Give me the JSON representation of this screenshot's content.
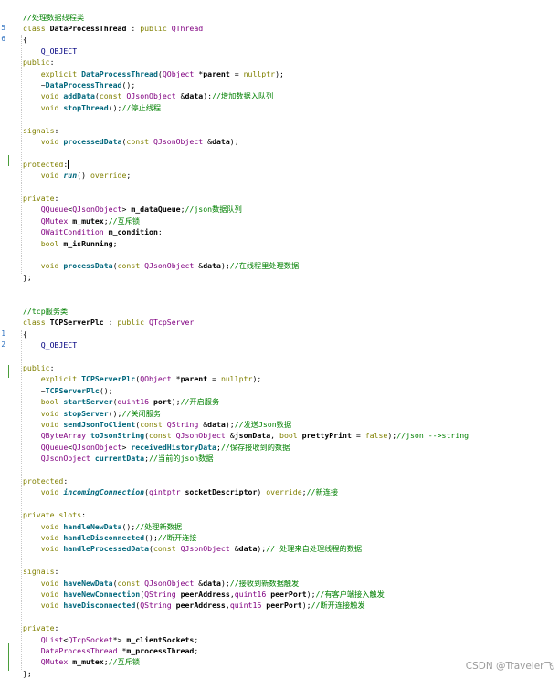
{
  "watermark": "CSDN @Traveler飞",
  "gutter_numbers": {
    "l1": "5",
    "l2": "6",
    "l28": "1",
    "l29": "2"
  },
  "lines": [
    [
      [
        "cm",
        "//处理数据线程类"
      ]
    ],
    [
      [
        "kw",
        "class "
      ],
      [
        "id",
        "DataProcessThread"
      ],
      [
        "pl",
        " : "
      ],
      [
        "kw",
        "public "
      ],
      [
        "ty",
        "QThread"
      ]
    ],
    [
      [
        "pl",
        "{"
      ]
    ],
    [
      [
        "pl",
        "    "
      ],
      [
        "mac",
        "Q_OBJECT"
      ]
    ],
    [
      [
        "kw",
        "public"
      ],
      [
        "pl",
        ":"
      ]
    ],
    [
      [
        "pl",
        "    "
      ],
      [
        "kw",
        "explicit "
      ],
      [
        "fn",
        "DataProcessThread"
      ],
      [
        "pl",
        "("
      ],
      [
        "ty",
        "QObject"
      ],
      [
        "pl",
        " *"
      ],
      [
        "id",
        "parent"
      ],
      [
        "pl",
        " = "
      ],
      [
        "kw",
        "nullptr"
      ],
      [
        "pl",
        ");"
      ]
    ],
    [
      [
        "pl",
        "    ~"
      ],
      [
        "fn",
        "DataProcessThread"
      ],
      [
        "pl",
        "();"
      ]
    ],
    [
      [
        "pl",
        "    "
      ],
      [
        "kw",
        "void "
      ],
      [
        "fn",
        "addData"
      ],
      [
        "pl",
        "("
      ],
      [
        "kw",
        "const "
      ],
      [
        "ty",
        "QJsonObject"
      ],
      [
        "pl",
        " &"
      ],
      [
        "id",
        "data"
      ],
      [
        "pl",
        ");"
      ],
      [
        "cm",
        "//增加数据入队列"
      ]
    ],
    [
      [
        "pl",
        "    "
      ],
      [
        "kw",
        "void "
      ],
      [
        "fn",
        "stopThread"
      ],
      [
        "pl",
        "();"
      ],
      [
        "cm",
        "//停止线程"
      ]
    ],
    [],
    [
      [
        "kw",
        "signals"
      ],
      [
        "pl",
        ":"
      ]
    ],
    [
      [
        "pl",
        "    "
      ],
      [
        "kw",
        "void "
      ],
      [
        "fn",
        "processedData"
      ],
      [
        "pl",
        "("
      ],
      [
        "kw",
        "const "
      ],
      [
        "ty",
        "QJsonObject"
      ],
      [
        "pl",
        " &"
      ],
      [
        "id",
        "data"
      ],
      [
        "pl",
        ");"
      ]
    ],
    [],
    [
      [
        "kw",
        "protected"
      ],
      [
        "pl",
        ":"
      ],
      [
        "cursor",
        ""
      ]
    ],
    [
      [
        "pl",
        "    "
      ],
      [
        "kw",
        "void "
      ],
      [
        "it",
        "run"
      ],
      [
        "pl",
        "() "
      ],
      [
        "kw",
        "override"
      ],
      [
        "pl",
        ";"
      ]
    ],
    [],
    [
      [
        "kw",
        "private"
      ],
      [
        "pl",
        ":"
      ]
    ],
    [
      [
        "pl",
        "    "
      ],
      [
        "ty",
        "QQueue"
      ],
      [
        "pl",
        "<"
      ],
      [
        "ty",
        "QJsonObject"
      ],
      [
        "pl",
        "> "
      ],
      [
        "id",
        "m_dataQueue"
      ],
      [
        "pl",
        ";"
      ],
      [
        "cm",
        "//json数据队列"
      ]
    ],
    [
      [
        "pl",
        "    "
      ],
      [
        "ty",
        "QMutex"
      ],
      [
        "pl",
        " "
      ],
      [
        "id",
        "m_mutex"
      ],
      [
        "pl",
        ";"
      ],
      [
        "cm",
        "//互斥锁"
      ]
    ],
    [
      [
        "pl",
        "    "
      ],
      [
        "ty",
        "QWaitCondition"
      ],
      [
        "pl",
        " "
      ],
      [
        "id",
        "m_condition"
      ],
      [
        "pl",
        ";"
      ]
    ],
    [
      [
        "pl",
        "    "
      ],
      [
        "kw",
        "bool "
      ],
      [
        "id",
        "m_isRunning"
      ],
      [
        "pl",
        ";"
      ]
    ],
    [],
    [
      [
        "pl",
        "    "
      ],
      [
        "kw",
        "void "
      ],
      [
        "fn",
        "processData"
      ],
      [
        "pl",
        "("
      ],
      [
        "kw",
        "const "
      ],
      [
        "ty",
        "QJsonObject"
      ],
      [
        "pl",
        " &"
      ],
      [
        "id",
        "data"
      ],
      [
        "pl",
        ");"
      ],
      [
        "cm",
        "//在线程里处理数据"
      ]
    ],
    [
      [
        "pl",
        "};"
      ]
    ],
    [],
    [],
    [
      [
        "cm",
        "//tcp服务类"
      ]
    ],
    [
      [
        "kw",
        "class "
      ],
      [
        "id",
        "TCPServerPlc"
      ],
      [
        "pl",
        " : "
      ],
      [
        "kw",
        "public "
      ],
      [
        "ty",
        "QTcpServer"
      ]
    ],
    [
      [
        "pl",
        "{"
      ]
    ],
    [
      [
        "pl",
        "    "
      ],
      [
        "mac",
        "Q_OBJECT"
      ]
    ],
    [],
    [
      [
        "kw",
        "public"
      ],
      [
        "pl",
        ":"
      ]
    ],
    [
      [
        "pl",
        "    "
      ],
      [
        "kw",
        "explicit "
      ],
      [
        "fn",
        "TCPServerPlc"
      ],
      [
        "pl",
        "("
      ],
      [
        "ty",
        "QObject"
      ],
      [
        "pl",
        " *"
      ],
      [
        "id",
        "parent"
      ],
      [
        "pl",
        " = "
      ],
      [
        "kw",
        "nullptr"
      ],
      [
        "pl",
        ");"
      ]
    ],
    [
      [
        "pl",
        "    ~"
      ],
      [
        "fn",
        "TCPServerPlc"
      ],
      [
        "pl",
        "();"
      ]
    ],
    [
      [
        "pl",
        "    "
      ],
      [
        "kw",
        "bool "
      ],
      [
        "fn",
        "startServer"
      ],
      [
        "pl",
        "("
      ],
      [
        "ty",
        "quint16"
      ],
      [
        "pl",
        " "
      ],
      [
        "id",
        "port"
      ],
      [
        "pl",
        ");"
      ],
      [
        "cm",
        "//开启服务"
      ]
    ],
    [
      [
        "pl",
        "    "
      ],
      [
        "kw",
        "void "
      ],
      [
        "fn",
        "stopServer"
      ],
      [
        "pl",
        "();"
      ],
      [
        "cm",
        "//关闭服务"
      ]
    ],
    [
      [
        "pl",
        "    "
      ],
      [
        "kw",
        "void "
      ],
      [
        "fn",
        "sendJsonToClient"
      ],
      [
        "pl",
        "("
      ],
      [
        "kw",
        "const "
      ],
      [
        "ty",
        "QString"
      ],
      [
        "pl",
        " &"
      ],
      [
        "id",
        "data"
      ],
      [
        "pl",
        ");"
      ],
      [
        "cm",
        "//发送Json数据"
      ]
    ],
    [
      [
        "pl",
        "    "
      ],
      [
        "ty",
        "QByteArray"
      ],
      [
        "pl",
        " "
      ],
      [
        "fn",
        "toJsonString"
      ],
      [
        "pl",
        "("
      ],
      [
        "kw",
        "const "
      ],
      [
        "ty",
        "QJsonObject"
      ],
      [
        "pl",
        " &"
      ],
      [
        "id",
        "jsonData"
      ],
      [
        "pl",
        ", "
      ],
      [
        "kw",
        "bool "
      ],
      [
        "id",
        "prettyPrint"
      ],
      [
        "pl",
        " = "
      ],
      [
        "kw",
        "false"
      ],
      [
        "pl",
        ");"
      ],
      [
        "cm",
        "//json -->string"
      ]
    ],
    [
      [
        "pl",
        "    "
      ],
      [
        "ty",
        "QQueue"
      ],
      [
        "pl",
        "<"
      ],
      [
        "ty",
        "QJsonObject"
      ],
      [
        "pl",
        "> "
      ],
      [
        "fn",
        "receivedHistoryData"
      ],
      [
        "pl",
        ";"
      ],
      [
        "cm",
        "//保存接收到的数据"
      ]
    ],
    [
      [
        "pl",
        "    "
      ],
      [
        "ty",
        "QJsonObject"
      ],
      [
        "pl",
        " "
      ],
      [
        "fn",
        "currentData"
      ],
      [
        "pl",
        ";"
      ],
      [
        "cm",
        "//当前的json数据"
      ]
    ],
    [],
    [
      [
        "kw",
        "protected"
      ],
      [
        "pl",
        ":"
      ]
    ],
    [
      [
        "pl",
        "    "
      ],
      [
        "kw",
        "void "
      ],
      [
        "it",
        "incomingConnection"
      ],
      [
        "pl",
        "("
      ],
      [
        "ty",
        "qintptr"
      ],
      [
        "pl",
        " "
      ],
      [
        "id",
        "socketDescriptor"
      ],
      [
        "pl",
        ") "
      ],
      [
        "kw",
        "override"
      ],
      [
        "pl",
        ";"
      ],
      [
        "cm",
        "//新连接"
      ]
    ],
    [],
    [
      [
        "kw",
        "private slots"
      ],
      [
        "pl",
        ":"
      ]
    ],
    [
      [
        "pl",
        "    "
      ],
      [
        "kw",
        "void "
      ],
      [
        "fn",
        "handleNewData"
      ],
      [
        "pl",
        "();"
      ],
      [
        "cm",
        "//处理新数据"
      ]
    ],
    [
      [
        "pl",
        "    "
      ],
      [
        "kw",
        "void "
      ],
      [
        "fn",
        "handleDisconnected"
      ],
      [
        "pl",
        "();"
      ],
      [
        "cm",
        "//断开连接"
      ]
    ],
    [
      [
        "pl",
        "    "
      ],
      [
        "kw",
        "void "
      ],
      [
        "fn",
        "handleProcessedData"
      ],
      [
        "pl",
        "("
      ],
      [
        "kw",
        "const "
      ],
      [
        "ty",
        "QJsonObject"
      ],
      [
        "pl",
        " &"
      ],
      [
        "id",
        "data"
      ],
      [
        "pl",
        ");"
      ],
      [
        "cm",
        "// 处理来自处理线程的数据"
      ]
    ],
    [],
    [
      [
        "kw",
        "signals"
      ],
      [
        "pl",
        ":"
      ]
    ],
    [
      [
        "pl",
        "    "
      ],
      [
        "kw",
        "void "
      ],
      [
        "fn",
        "haveNewData"
      ],
      [
        "pl",
        "("
      ],
      [
        "kw",
        "const "
      ],
      [
        "ty",
        "QJsonObject"
      ],
      [
        "pl",
        " &"
      ],
      [
        "id",
        "data"
      ],
      [
        "pl",
        ");"
      ],
      [
        "cm",
        "//接收到新数据触发"
      ]
    ],
    [
      [
        "pl",
        "    "
      ],
      [
        "kw",
        "void "
      ],
      [
        "fn",
        "haveNewConnection"
      ],
      [
        "pl",
        "("
      ],
      [
        "ty",
        "QString"
      ],
      [
        "pl",
        " "
      ],
      [
        "id",
        "peerAddress"
      ],
      [
        "pl",
        ","
      ],
      [
        "ty",
        "quint16"
      ],
      [
        "pl",
        " "
      ],
      [
        "id",
        "peerPort"
      ],
      [
        "pl",
        ");"
      ],
      [
        "cm",
        "//有客户端接入触发"
      ]
    ],
    [
      [
        "pl",
        "    "
      ],
      [
        "kw",
        "void "
      ],
      [
        "fn",
        "haveDisconnected"
      ],
      [
        "pl",
        "("
      ],
      [
        "ty",
        "QString"
      ],
      [
        "pl",
        " "
      ],
      [
        "id",
        "peerAddress"
      ],
      [
        "pl",
        ","
      ],
      [
        "ty",
        "quint16"
      ],
      [
        "pl",
        " "
      ],
      [
        "id",
        "peerPort"
      ],
      [
        "pl",
        ");"
      ],
      [
        "cm",
        "//断开连接触发"
      ]
    ],
    [],
    [
      [
        "kw",
        "private"
      ],
      [
        "pl",
        ":"
      ]
    ],
    [
      [
        "pl",
        "    "
      ],
      [
        "ty",
        "QList"
      ],
      [
        "pl",
        "<"
      ],
      [
        "ty",
        "QTcpSocket"
      ],
      [
        "pl",
        "*> "
      ],
      [
        "id",
        "m_clientSockets"
      ],
      [
        "pl",
        ";"
      ]
    ],
    [
      [
        "pl",
        "    "
      ],
      [
        "ty",
        "DataProcessThread"
      ],
      [
        "pl",
        " *"
      ],
      [
        "id",
        "m_processThread"
      ],
      [
        "pl",
        ";"
      ]
    ],
    [
      [
        "pl",
        "    "
      ],
      [
        "ty",
        "QMutex"
      ],
      [
        "pl",
        " "
      ],
      [
        "id",
        "m_mutex"
      ],
      [
        "pl",
        ";"
      ],
      [
        "cm",
        "//互斥锁"
      ]
    ],
    [
      [
        "pl",
        "};"
      ]
    ]
  ]
}
